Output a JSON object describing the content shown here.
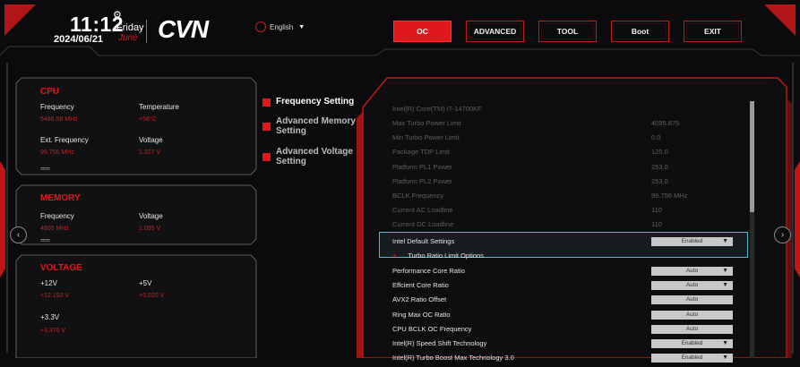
{
  "header": {
    "time": "11:12",
    "day": "Friday",
    "date": "2024/06/21",
    "month": "June",
    "brand": "CVN",
    "language": "English"
  },
  "tabs": [
    {
      "label": "OC",
      "active": true
    },
    {
      "label": "ADVANCED",
      "active": false
    },
    {
      "label": "TOOL",
      "active": false
    },
    {
      "label": "Boot",
      "active": false
    },
    {
      "label": "EXIT",
      "active": false
    }
  ],
  "cpu": {
    "title": "CPU",
    "frequency_label": "Frequency",
    "frequency_value": "5486.58 MHz",
    "temperature_label": "Temperature",
    "temperature_value": "+56°C",
    "ext_frequency_label": "Ext. Frequency",
    "ext_frequency_value": "99.756 MHz",
    "voltage_label": "Voltage",
    "voltage_value": "1.327 V"
  },
  "memory": {
    "title": "MEMORY",
    "frequency_label": "Frequency",
    "frequency_value": "4800 MHz",
    "voltage_label": "Voltage",
    "voltage_value": "1.095 V"
  },
  "voltage": {
    "title": "VOLTAGE",
    "v12_label": "+12V",
    "v12_value": "+12.192 V",
    "v5_label": "+5V",
    "v5_value": "+5.020 V",
    "v33_label": "+3.3V",
    "v33_value": "+3.376 V"
  },
  "menu": [
    {
      "label": "Frequency Setting",
      "active": true
    },
    {
      "label": "Advanced Memory Setting",
      "active": false
    },
    {
      "label": "Advanced Voltage Setting",
      "active": false
    }
  ],
  "settings": [
    {
      "name": "Intel(R) Core(TM) i7-14700KF",
      "value": "",
      "disabled": true
    },
    {
      "name": "Max Turbo Power Limit",
      "value": "4095.875",
      "disabled": true
    },
    {
      "name": "Min Turbo Power Limit",
      "value": "0.0",
      "disabled": true
    },
    {
      "name": "Package TDP Limit",
      "value": "125.0",
      "disabled": true
    },
    {
      "name": "Platform PL1 Power",
      "value": "253.0",
      "disabled": true
    },
    {
      "name": "Platform PL2 Power",
      "value": "253.0",
      "disabled": true
    },
    {
      "name": "BCLK Frequency",
      "value": "99.756 MHz",
      "disabled": true
    },
    {
      "name": "Current AC Loadline",
      "value": "110",
      "disabled": true
    },
    {
      "name": "Current DC Loadline",
      "value": "110",
      "disabled": true
    },
    {
      "name": "Intel Default Settings",
      "value": "Enabled",
      "dropdown": true,
      "selected": true
    },
    {
      "name": "Turbo Ratio Limit Options",
      "value": "",
      "submenu": true
    },
    {
      "name": "Performance Core Ratio",
      "value": "Auto",
      "dropdown": true
    },
    {
      "name": "Effcient Core Ratio",
      "value": "Auto",
      "dropdown": true
    },
    {
      "name": "AVX2 Ratio Offset",
      "value": "Auto",
      "dropdown": false
    },
    {
      "name": "Ring Max OC Ratio",
      "value": "Auto",
      "dropdown": false
    },
    {
      "name": "CPU BCLK OC Frequency",
      "value": "Auto",
      "dropdown": false
    },
    {
      "name": "Intel(R) Speed Shift Technology",
      "value": "Enabled",
      "dropdown": true
    },
    {
      "name": "Intel(R) Turbo Boost Max Technology 3.0",
      "value": "Enabled",
      "dropdown": true
    }
  ],
  "icons": {
    "gear": "gear-icon",
    "globe": "globe-icon",
    "left_nav": "chevron-left-icon",
    "right_nav": "chevron-right-icon"
  },
  "colors": {
    "accent": "#e0181b",
    "value_red": "#d81a1a",
    "highlight": "#3fc2d0",
    "background": "#0b0b0d"
  }
}
